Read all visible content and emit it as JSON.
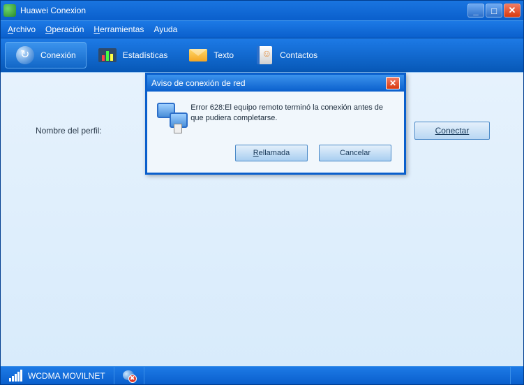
{
  "window": {
    "title": "Huawei Conexion"
  },
  "menu": {
    "archivo": "Archivo",
    "operacion": "Operación",
    "herramientas": "Herramientas",
    "ayuda": "Ayuda"
  },
  "tabs": {
    "conexion": "Conexión",
    "estadisticas": "Estadísticas",
    "texto": "Texto",
    "contactos": "Contactos"
  },
  "profile": {
    "label": "Nombre del perfil:",
    "connect": "Conectar"
  },
  "dialog": {
    "title": "Aviso de conexión de red",
    "message": "Error 628:El equipo remoto terminó la conexión antes de que pudiera completarse.",
    "retry_prefix": "R",
    "retry_rest": "ellamada",
    "cancel": "Cancelar"
  },
  "status": {
    "network": "WCDMA  MOVILNET"
  }
}
